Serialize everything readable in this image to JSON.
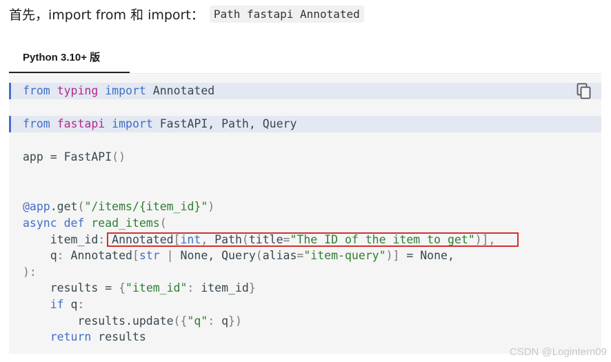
{
  "intro": {
    "text": "首先，import from 和 import：",
    "code": "Path fastapi Annotated"
  },
  "tabs": [
    {
      "label": "Python 3.10+ 版"
    }
  ],
  "code": {
    "lines": [
      [
        [
          "kw",
          "from"
        ],
        [
          "",
          " "
        ],
        [
          "md",
          "typing"
        ],
        [
          "",
          " "
        ],
        [
          "kw",
          "import"
        ],
        [
          "",
          " Annotated"
        ]
      ],
      [],
      [
        [
          "kw",
          "from"
        ],
        [
          "",
          " "
        ],
        [
          "md",
          "fastapi"
        ],
        [
          "",
          " "
        ],
        [
          "kw",
          "import"
        ],
        [
          "",
          " FastAPI, Path, Query"
        ]
      ],
      [],
      [
        [
          "",
          "app = FastAPI"
        ],
        [
          "pn",
          "()"
        ]
      ],
      [],
      [],
      [
        [
          "kw",
          "@app"
        ],
        [
          "",
          ".get"
        ],
        [
          "pn",
          "("
        ],
        [
          "st",
          "\"/items/{item_id}\""
        ],
        [
          "pn",
          ")"
        ]
      ],
      [
        [
          "kw",
          "async def"
        ],
        [
          "",
          " "
        ],
        [
          "st",
          "read_items"
        ],
        [
          "pn",
          "("
        ]
      ],
      [
        [
          "",
          "    item_id"
        ],
        [
          "pn",
          ":"
        ],
        [
          "",
          " Annotated"
        ],
        [
          "pn",
          "["
        ],
        [
          "kw",
          "int"
        ],
        [
          "pn",
          ","
        ],
        [
          "",
          " Path"
        ],
        [
          "pn",
          "("
        ],
        [
          "",
          "title"
        ],
        [
          "pn",
          "="
        ],
        [
          "st",
          "\"The ID of the item to get\""
        ],
        [
          "pn",
          ")],"
        ]
      ],
      [
        [
          "",
          "    q"
        ],
        [
          "pn",
          ":"
        ],
        [
          "",
          " Annotated"
        ],
        [
          "pn",
          "["
        ],
        [
          "kw",
          "str"
        ],
        [
          "",
          " "
        ],
        [
          "pn",
          "|"
        ],
        [
          "",
          " None, Query"
        ],
        [
          "pn",
          "("
        ],
        [
          "",
          "alias"
        ],
        [
          "pn",
          "="
        ],
        [
          "st",
          "\"item-query\""
        ],
        [
          "pn",
          ")]"
        ],
        [
          "",
          " = None,"
        ]
      ],
      [
        [
          "pn",
          "):"
        ]
      ],
      [
        [
          "",
          "    results = "
        ],
        [
          "pn",
          "{"
        ],
        [
          "st",
          "\"item_id\""
        ],
        [
          "pn",
          ":"
        ],
        [
          "",
          " item_id"
        ],
        [
          "pn",
          "}"
        ]
      ],
      [
        [
          "kw",
          "    if"
        ],
        [
          "",
          " q"
        ],
        [
          "pn",
          ":"
        ]
      ],
      [
        [
          "",
          "        results.update"
        ],
        [
          "pn",
          "({"
        ],
        [
          "st",
          "\"q\""
        ],
        [
          "pn",
          ":"
        ],
        [
          "",
          " q"
        ],
        [
          "pn",
          "})"
        ]
      ],
      [
        [
          "kw",
          "    return"
        ],
        [
          "",
          " results"
        ]
      ]
    ],
    "highlighted_lines": [
      0,
      2
    ]
  },
  "watermark": "CSDN @Logintern09"
}
